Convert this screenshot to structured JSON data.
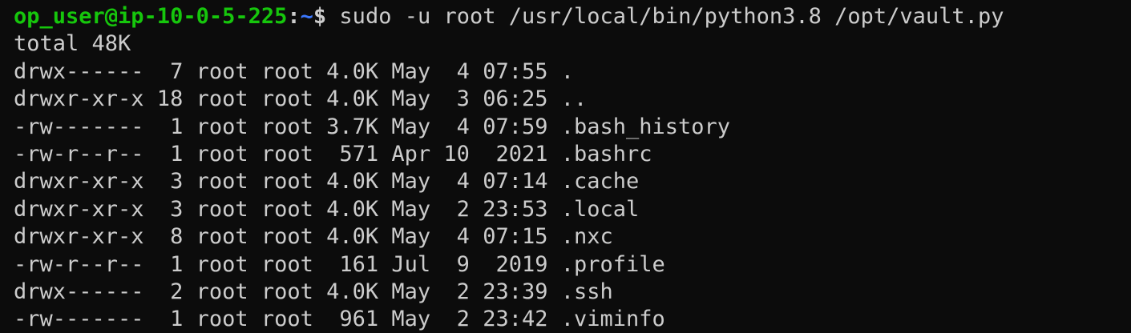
{
  "colors": {
    "background": "#0c0c0c",
    "text": "#cccccc",
    "user_host": "#16c60c",
    "path": "#3b78ff"
  },
  "prompt": {
    "user_host": "op_user@ip-10-0-5-225",
    "separator": ":",
    "path": "~",
    "symbol": "$",
    "command": " sudo -u root /usr/local/bin/python3.8 /opt/vault.py"
  },
  "output": {
    "total": "total 48K",
    "entries": [
      "drwx------  7 root root 4.0K May  4 07:55 .",
      "drwxr-xr-x 18 root root 4.0K May  3 06:25 ..",
      "-rw-------  1 root root 3.7K May  4 07:59 .bash_history",
      "-rw-r--r--  1 root root  571 Apr 10  2021 .bashrc",
      "drwxr-xr-x  3 root root 4.0K May  4 07:14 .cache",
      "drwxr-xr-x  3 root root 4.0K May  2 23:53 .local",
      "drwxr-xr-x  8 root root 4.0K May  4 07:15 .nxc",
      "-rw-r--r--  1 root root  161 Jul  9  2019 .profile",
      "drwx------  2 root root 4.0K May  2 23:39 .ssh",
      "-rw-------  1 root root  961 May  2 23:42 .viminfo"
    ]
  }
}
